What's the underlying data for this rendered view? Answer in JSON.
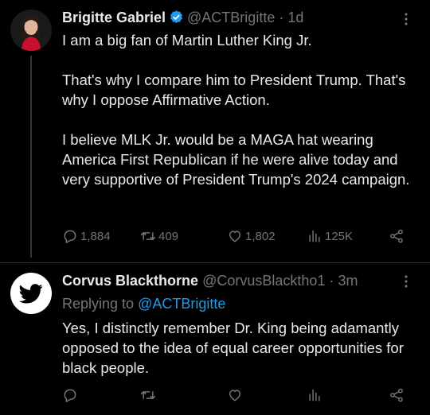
{
  "tweet1": {
    "author_name": "Brigitte Gabriel",
    "handle": "@ACTBrigitte",
    "separator": "·",
    "time": "1d",
    "paragraphs": [
      "I am a big fan of Martin Luther King Jr.",
      "That's why I compare him to President Trump. That's why I oppose Affirmative Action.",
      "I believe MLK Jr. would be a MAGA hat wearing America First Republican if he were alive today and very supportive of President Trump's 2024 campaign."
    ],
    "replies": "1,884",
    "retweets": "409",
    "likes": "1,802",
    "views": "125K"
  },
  "tweet2": {
    "author_name": "Corvus Blackthorne",
    "handle": "@CorvusBlacktho1",
    "separator": "·",
    "time": "3m",
    "replying_prefix": "Replying to",
    "replying_to": "@ACTBrigitte",
    "text": "Yes, I distinctly remember Dr. King being adamantly opposed to the idea of equal career opportunities for black people."
  },
  "colors": {
    "background": "#000000",
    "text": "#e7e9ea",
    "muted": "#71767b",
    "link": "#1d9bf0",
    "verified": "#1d9bf0",
    "divider": "#2f3336"
  },
  "icons": {
    "reply": "reply-icon",
    "retweet": "retweet-icon",
    "like": "heart-icon",
    "views": "views-icon",
    "share": "share-icon",
    "more": "more-icon",
    "verified": "verified-badge-icon"
  }
}
